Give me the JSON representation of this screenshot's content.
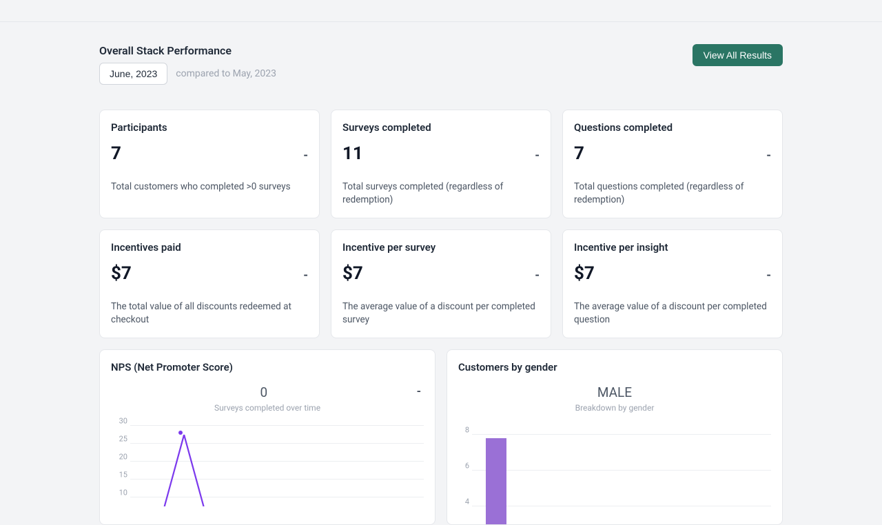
{
  "header": {
    "title": "Overall Stack Performance",
    "view_all_label": "View All Results",
    "period": "June, 2023",
    "compared": "compared to May, 2023"
  },
  "metrics": [
    {
      "title": "Participants",
      "value": "7",
      "delta": "-",
      "desc": "Total customers who completed >0 surveys"
    },
    {
      "title": "Surveys completed",
      "value": "11",
      "delta": "-",
      "desc": "Total surveys completed (regardless of redemption)"
    },
    {
      "title": "Questions completed",
      "value": "7",
      "delta": "-",
      "desc": "Total questions completed (regardless of redemption)"
    },
    {
      "title": "Incentives paid",
      "value": "$7",
      "delta": "-",
      "desc": "The total value of all discounts redeemed at checkout"
    },
    {
      "title": "Incentive per survey",
      "value": "$7",
      "delta": "-",
      "desc": "The average value of a discount per completed survey"
    },
    {
      "title": "Incentive per insight",
      "value": "$7",
      "delta": "-",
      "desc": "The average value of a discount per completed question"
    }
  ],
  "charts": {
    "nps": {
      "title": "NPS (Net Promoter Score)",
      "headline": "0",
      "delta": "-",
      "subtitle": "Surveys completed over time",
      "y_ticks": [
        "30",
        "25",
        "20",
        "15",
        "10"
      ]
    },
    "gender": {
      "title": "Customers by gender",
      "headline": "MALE",
      "subtitle": "Breakdown by gender",
      "y_ticks": [
        "8",
        "6",
        "4"
      ]
    }
  },
  "chart_data": [
    {
      "type": "line",
      "title": "Surveys completed over time",
      "ylim": [
        0,
        30
      ],
      "y_ticks": [
        10,
        15,
        20,
        25,
        30
      ],
      "series": [
        {
          "name": "surveys",
          "values": [
            0,
            25,
            0
          ]
        }
      ]
    },
    {
      "type": "bar",
      "title": "Breakdown by gender",
      "ylim": [
        0,
        8
      ],
      "y_ticks": [
        4,
        6,
        8
      ],
      "categories": [
        "MALE"
      ],
      "values": [
        7
      ]
    }
  ],
  "colors": {
    "accent": "#2a7564",
    "chart_purple": "#9a70d6"
  }
}
